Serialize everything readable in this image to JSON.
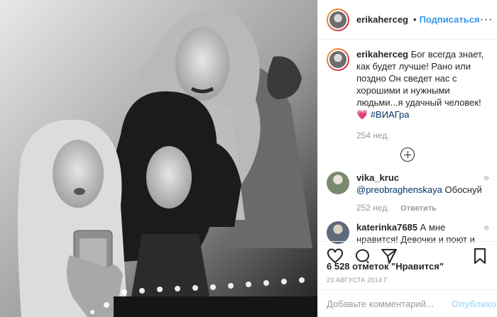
{
  "post": {
    "username": "erikaherceg",
    "follow_label": "Подписаться",
    "separator": "•",
    "more_label": "···",
    "caption_text": "Бог всегда знает, как будет лучше! Рано или поздно Он сведет нас с хорошими и нужными людьми...я удачный человек!💗",
    "caption_hashtag": "#ВИАГра",
    "caption_time": "254 нед.",
    "likes": "6 528 отметок \"Нравится\"",
    "date": "23 АВГУСТА 2014 Г."
  },
  "comments": [
    {
      "username": "vika_kruc",
      "mention": "@preobraghenskaya",
      "text": "Обоснуй",
      "time": "252 нед.",
      "reply_label": "Ответить"
    },
    {
      "username": "katerinka7685",
      "mention": "",
      "text": "А мне нравится! Девочки и поют и двигаются sexy!!! ;)",
      "time": "",
      "reply_label": ""
    }
  ],
  "add_comment": {
    "placeholder": "Добавьте комментарий...",
    "publish_label": "Опубликовать"
  },
  "colors": {
    "accent": "#3897f0",
    "verified": "#3897f0",
    "muted": "#999999",
    "hashtag": "#003569",
    "publish_disabled": "#b2dffc"
  },
  "icons": [
    "verified-badge-icon",
    "plus-circle-icon",
    "heart-icon",
    "comment-icon",
    "share-icon",
    "bookmark-icon",
    "more-options-icon"
  ]
}
